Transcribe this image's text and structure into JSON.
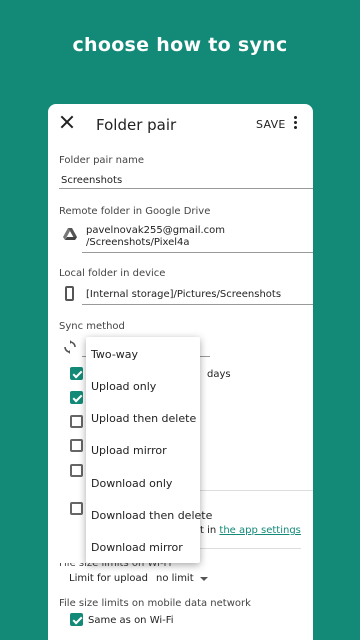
{
  "promo": {
    "title": "choose how to sync"
  },
  "appbar": {
    "title": "Folder pair",
    "save_label": "SAVE",
    "close_icon": "close-icon",
    "more_icon": "more-vert-icon"
  },
  "form": {
    "pair_name": {
      "label": "Folder pair name",
      "value": "Screenshots"
    },
    "remote": {
      "label": "Remote folder in Google Drive",
      "account": "pavelnovak255@gmail.com",
      "path": "/Screenshots/Pixel4a",
      "icon": "google-drive-icon"
    },
    "local": {
      "label": "Local folder in device",
      "path": "[Internal storage]/Pictures/Screenshots",
      "icon": "phone-icon"
    },
    "sync_method": {
      "label": "Sync method",
      "icon": "sync-icon"
    },
    "option_suffix": "days",
    "settings_note": {
      "prefix": "t in ",
      "link": "the app settings"
    },
    "wifi_limits": {
      "label_partial": "File size limits on Wi-Fi",
      "limit_label": "Limit for upload",
      "limit_value": "no limit"
    },
    "mobile_limits": {
      "label": "File size limits on mobile data network",
      "same_as_wifi": "Same as on Wi-Fi"
    }
  },
  "checkboxes": [
    {
      "checked": true
    },
    {
      "checked": true
    },
    {
      "checked": false
    },
    {
      "checked": false
    },
    {
      "checked": false
    },
    {
      "checked": false
    }
  ],
  "menu": {
    "items": [
      "Two-way",
      "Upload only",
      "Upload then delete",
      "Upload mirror",
      "Download only",
      "Download then delete",
      "Download mirror"
    ]
  },
  "colors": {
    "accent": "#138a78",
    "background": "#138a78"
  }
}
